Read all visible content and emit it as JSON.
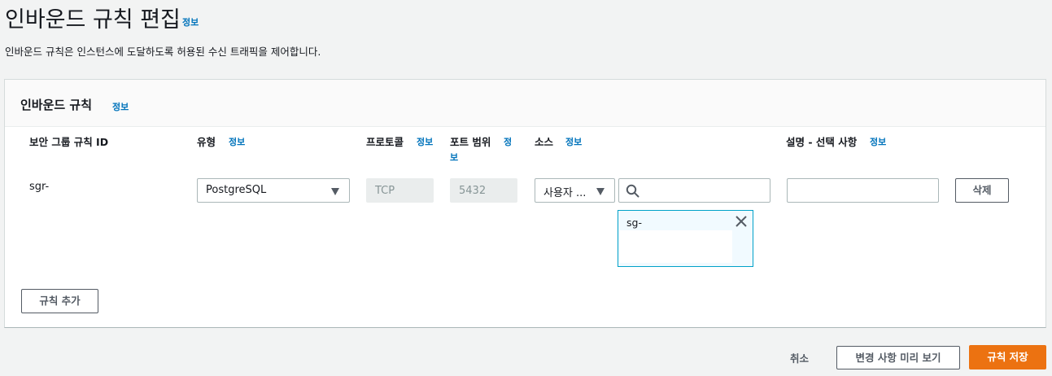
{
  "page": {
    "title": "인바운드 규칙 편집",
    "title_info": "정보",
    "description": "인바운드 규칙은 인스턴스에 도달하도록 허용된 수신 트래픽을 제어합니다."
  },
  "panel": {
    "title": "인바운드 규칙",
    "info": "정보",
    "columns": {
      "rule_id": "보안 그룹 규칙 ID",
      "type": "유형",
      "type_info": "정보",
      "protocol": "프로토콜",
      "protocol_info": "정보",
      "port_range": "포트 범위",
      "port_info_a": "정",
      "port_info_b": "보",
      "source": "소스",
      "source_info": "정보",
      "description": "설명 - 선택 사항",
      "description_info": "정보"
    },
    "rule": {
      "rule_id": "sgr-",
      "type_value": "PostgreSQL",
      "protocol_value": "TCP",
      "port_value": "5432",
      "source_value": "사용자 ...",
      "source_search_value": "",
      "description_value": "",
      "delete_label": "삭제",
      "source_token": "sg-"
    },
    "add_rule_label": "규칙 추가"
  },
  "footer": {
    "cancel_label": "취소",
    "preview_label": "변경 사항 미리 보기",
    "save_label": "규칙 저장"
  },
  "colors": {
    "link": "#0073bb",
    "primary": "#ec7211",
    "token_border": "#00a1c9",
    "token_bg": "#f1faff"
  }
}
